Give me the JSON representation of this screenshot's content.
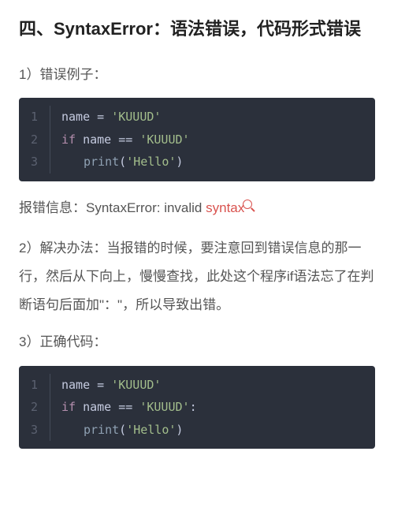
{
  "heading": "四、SyntaxError：语法错误，代码形式错误",
  "section1": {
    "title": "1）错误例子："
  },
  "code1": {
    "lines": [
      {
        "n": "1",
        "tokens": {
          "id": "name",
          "op": " = ",
          "str": "'KUUUD'"
        }
      },
      {
        "n": "2",
        "tokens": {
          "kw": "if",
          "sp": " ",
          "id": "name",
          "op": " == ",
          "str": "'KUUUD'"
        }
      },
      {
        "n": "3",
        "tokens": {
          "func": "print",
          "lp": "(",
          "str": "'Hello'",
          "rp": ")"
        }
      }
    ]
  },
  "error_line": {
    "prefix": "报错信息：",
    "text": "SyntaxError: invalid ",
    "syntax": "syntax"
  },
  "section2": {
    "title": "2）解决办法：",
    "body": "当报错的时候，要注意回到错误信息的那一行，然后从下向上，慢慢查找，此处这个程序if语法忘了在判断语句后面加\"：\"，所以导致出错。"
  },
  "section3": {
    "title": "3）正确代码："
  },
  "code2": {
    "lines": [
      {
        "n": "1",
        "tokens": {
          "id": "name",
          "op": " = ",
          "str": "'KUUUD'"
        }
      },
      {
        "n": "2",
        "tokens": {
          "kw": "if",
          "sp": " ",
          "id": "name",
          "op": " == ",
          "str": "'KUUUD'",
          "colon": ":"
        }
      },
      {
        "n": "3",
        "tokens": {
          "func": "print",
          "lp": "(",
          "str": "'Hello'",
          "rp": ")"
        }
      }
    ]
  }
}
